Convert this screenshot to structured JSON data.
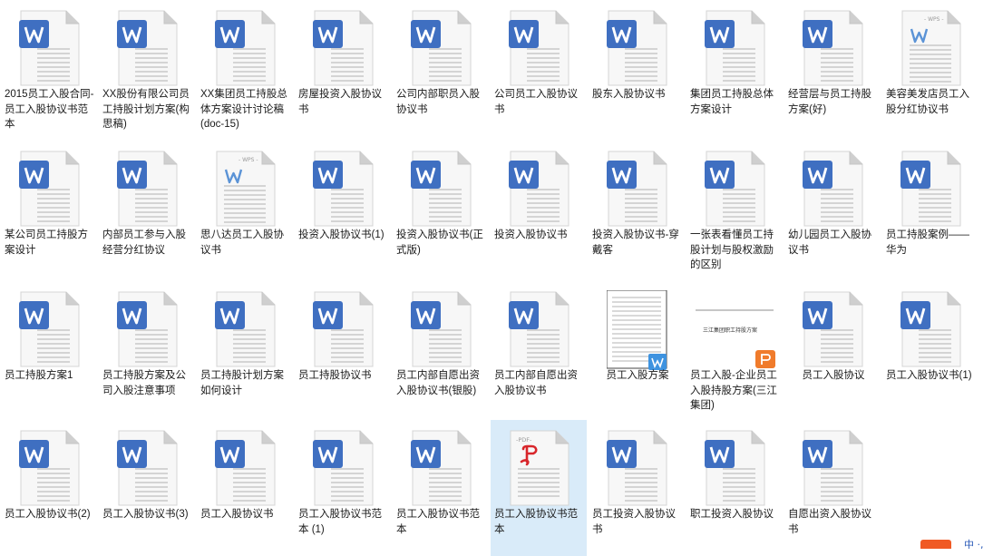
{
  "files": [
    {
      "type": "word",
      "name": "2015员工入股合同-员工入股协议书范本"
    },
    {
      "type": "word",
      "name": "XX股份有限公司员工持股计划方案(构思稿)"
    },
    {
      "type": "word",
      "name": "XX集团员工持股总体方案设计讨论稿(doc-15)"
    },
    {
      "type": "word",
      "name": "房屋投资入股协议书"
    },
    {
      "type": "word",
      "name": "公司内部职员入股协议书"
    },
    {
      "type": "word",
      "name": "公司员工入股协议书"
    },
    {
      "type": "word",
      "name": "股东入股协议书"
    },
    {
      "type": "word",
      "name": "集团员工持股总体方案设计"
    },
    {
      "type": "word",
      "name": "经营层与员工持股方案(好)"
    },
    {
      "type": "wps",
      "name": "美容美发店员工入股分红协议书"
    },
    {
      "type": "word",
      "name": "某公司员工持股方案设计"
    },
    {
      "type": "word",
      "name": "内部员工参与入股经营分红协议"
    },
    {
      "type": "wps",
      "name": "思八达员工入股协议书"
    },
    {
      "type": "word",
      "name": "投资入股协议书(1)"
    },
    {
      "type": "word",
      "name": "投资入股协议书(正式版)"
    },
    {
      "type": "word",
      "name": "投资入股协议书"
    },
    {
      "type": "word",
      "name": "投资入股协议书-穿戴客"
    },
    {
      "type": "word",
      "name": "一张表看懂员工持股计划与股权激励的区别"
    },
    {
      "type": "word",
      "name": "幼儿园员工入股协议书"
    },
    {
      "type": "word",
      "name": "员工持股案例——华为"
    },
    {
      "type": "word",
      "name": "员工持股方案1"
    },
    {
      "type": "word",
      "name": "员工持股方案及公司入股注意事项"
    },
    {
      "type": "word",
      "name": "员工持股计划方案如何设计"
    },
    {
      "type": "word",
      "name": "员工持股协议书"
    },
    {
      "type": "word",
      "name": "员工内部自愿出资入股协议书(银股)"
    },
    {
      "type": "word",
      "name": "员工内部自愿出资入股协议书"
    },
    {
      "type": "thumb-doc",
      "name": "员工入股方案"
    },
    {
      "type": "thumb-ppt",
      "name": "员工入股-企业员工入股持股方案(三江集团)",
      "thumb_text": "三江集团职工持股方案"
    },
    {
      "type": "word",
      "name": "员工入股协议"
    },
    {
      "type": "word",
      "name": "员工入股协议书(1)"
    },
    {
      "type": "word",
      "name": "员工入股协议书(2)"
    },
    {
      "type": "word",
      "name": "员工入股协议书(3)"
    },
    {
      "type": "word",
      "name": "员工入股协议书"
    },
    {
      "type": "word",
      "name": "员工入股协议书范本 (1)"
    },
    {
      "type": "word",
      "name": "员工入股协议书范本"
    },
    {
      "type": "pdf",
      "name": "员工入股协议书范本",
      "selected": true
    },
    {
      "type": "word",
      "name": "员工投资入股协议书"
    },
    {
      "type": "word",
      "name": "职工投资入股协议"
    },
    {
      "type": "word",
      "name": "自愿出资入股协议书"
    }
  ],
  "icon_labels": {
    "wps": "WPS",
    "pdf": "PDF"
  },
  "colors": {
    "word_blue": "#3f6fc1",
    "pdf_red": "#d8262b",
    "ppt_orange": "#f07b2b",
    "selection": "#d9ebf9"
  }
}
